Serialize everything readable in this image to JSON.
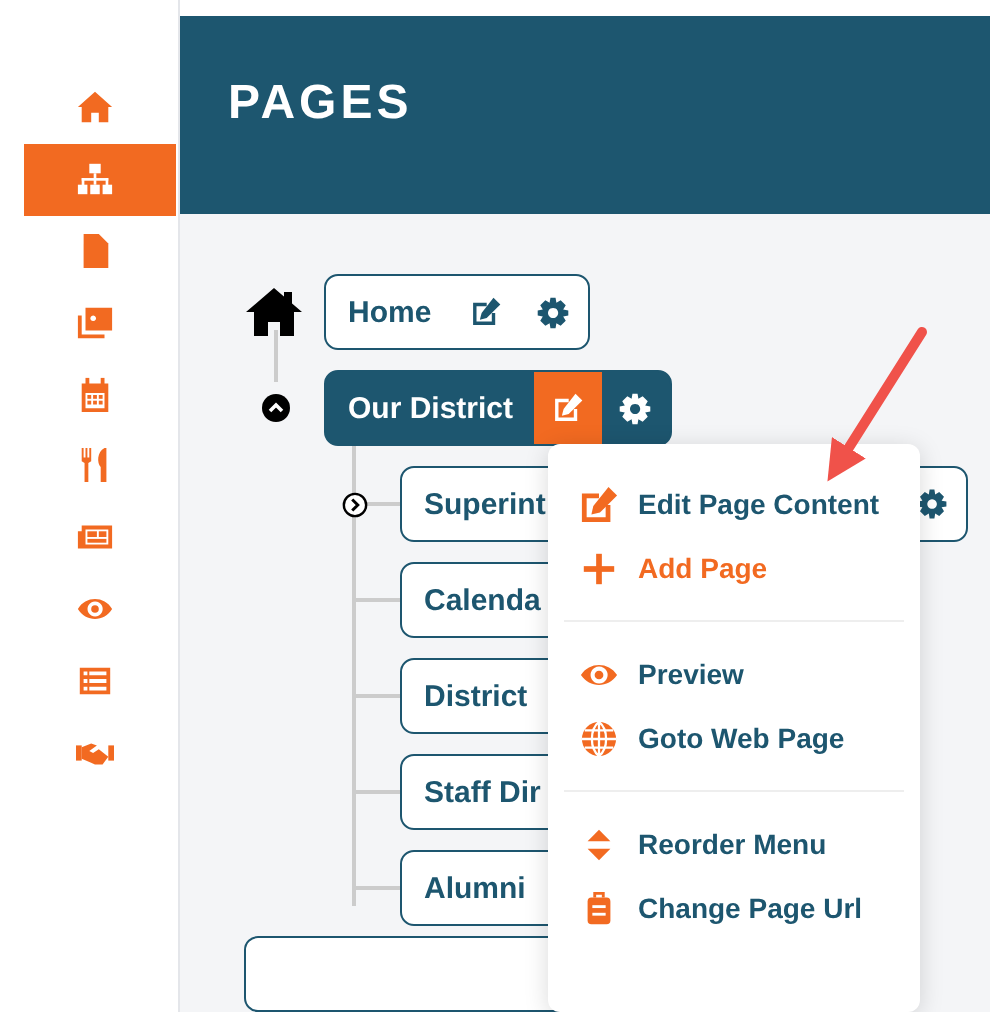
{
  "sidebar": {
    "items": [
      {
        "selected": false
      },
      {
        "selected": true
      },
      {
        "selected": false
      },
      {
        "selected": false
      },
      {
        "selected": false
      },
      {
        "selected": false
      },
      {
        "selected": false
      },
      {
        "selected": false
      },
      {
        "selected": false
      },
      {
        "selected": false
      }
    ]
  },
  "header": {
    "title": "PAGES"
  },
  "tree": {
    "root": {
      "label": "Home",
      "selected": false
    },
    "nodes": [
      {
        "label": "Our District",
        "selected": true,
        "expanded": true,
        "children": [
          {
            "label": "Superint",
            "expanded": false
          },
          {
            "label": "Calenda"
          },
          {
            "label": "District"
          },
          {
            "label": "Staff Dir"
          },
          {
            "label": "Alumni"
          }
        ]
      }
    ]
  },
  "context_menu": {
    "groups": [
      [
        {
          "label": "Edit Page Content",
          "selected": false
        },
        {
          "label": "Add Page",
          "selected": true
        }
      ],
      [
        {
          "label": "Preview",
          "selected": false
        },
        {
          "label": "Goto Web Page",
          "selected": false
        }
      ],
      [
        {
          "label": "Reorder Menu",
          "selected": false
        },
        {
          "label": "Change Page Url",
          "selected": false
        }
      ]
    ]
  }
}
